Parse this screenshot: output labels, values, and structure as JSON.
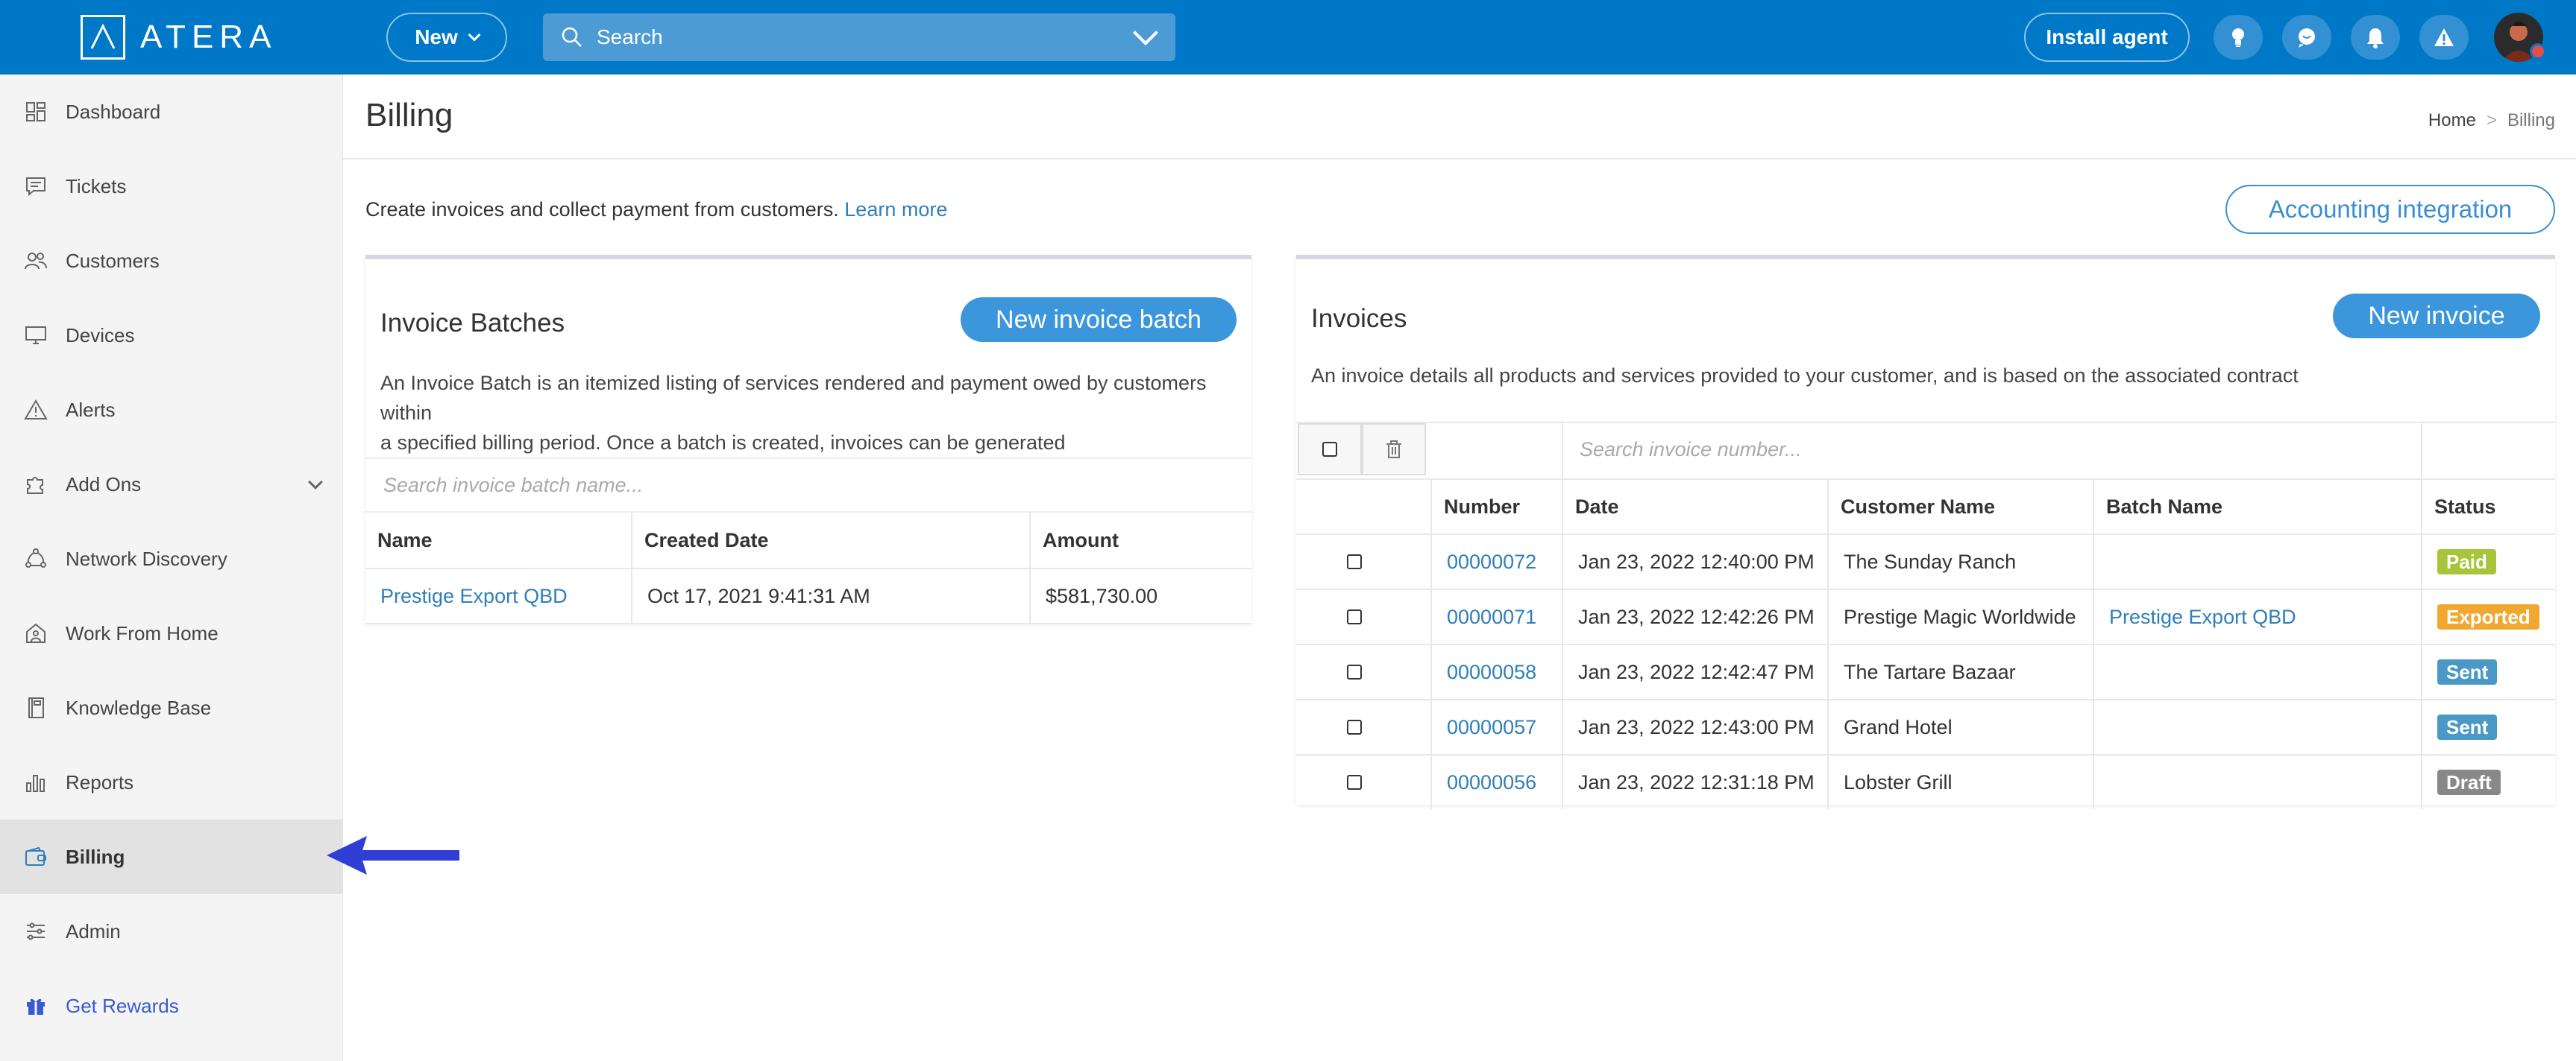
{
  "topbar": {
    "brand": "ATERA",
    "new_label": "New",
    "search_label": "Search",
    "install_label": "Install agent",
    "icons": [
      "lightbulb-icon",
      "chat-icon",
      "bell-icon",
      "warning-icon"
    ]
  },
  "sidebar": {
    "items": [
      {
        "label": "Dashboard",
        "icon": "dashboard-icon"
      },
      {
        "label": "Tickets",
        "icon": "tickets-icon"
      },
      {
        "label": "Customers",
        "icon": "customers-icon"
      },
      {
        "label": "Devices",
        "icon": "devices-icon"
      },
      {
        "label": "Alerts",
        "icon": "alerts-icon"
      },
      {
        "label": "Add Ons",
        "icon": "addons-icon"
      },
      {
        "label": "Network Discovery",
        "icon": "network-icon"
      },
      {
        "label": "Work From Home",
        "icon": "home-icon"
      },
      {
        "label": "Knowledge Base",
        "icon": "book-icon"
      },
      {
        "label": "Reports",
        "icon": "reports-icon"
      },
      {
        "label": "Billing",
        "icon": "wallet-icon"
      },
      {
        "label": "Admin",
        "icon": "sliders-icon"
      },
      {
        "label": "Get Rewards",
        "icon": "gift-icon"
      }
    ],
    "active": "Billing"
  },
  "page": {
    "title": "Billing",
    "breadcrumb": {
      "home": "Home",
      "sep": ">",
      "current": "Billing"
    },
    "intro_text": "Create invoices and collect payment from customers.",
    "learn_more": "Learn more",
    "accounting_label": "Accounting integration"
  },
  "batches": {
    "title": "Invoice Batches",
    "new_label": "New invoice batch",
    "description_line1": "An Invoice Batch is an itemized listing of services rendered and payment owed by customers within",
    "description_line2": "a specified billing period. Once a batch is created, invoices can be generated",
    "search_placeholder": "Search invoice batch name...",
    "columns": {
      "name": "Name",
      "created": "Created Date",
      "amount": "Amount"
    },
    "rows": [
      {
        "name": "Prestige Export QBD",
        "created": "Oct 17, 2021 9:41:31 AM",
        "amount": "$581,730.00"
      }
    ]
  },
  "invoices": {
    "title": "Invoices",
    "new_label": "New invoice",
    "description": "An invoice details all products and services provided to your customer, and is based on the associated contract",
    "search_placeholder": "Search invoice number...",
    "columns": {
      "number": "Number",
      "date": "Date",
      "customer": "Customer Name",
      "batch": "Batch Name",
      "status": "Status"
    },
    "rows": [
      {
        "number": "00000072",
        "date": "Jan 23, 2022 12:40:00 PM",
        "customer": "The Sunday Ranch",
        "batch": "",
        "status": "Paid",
        "status_color": "#a8c43a"
      },
      {
        "number": "00000071",
        "date": "Jan 23, 2022 12:42:26 PM",
        "customer": "Prestige Magic Worldwide",
        "batch": "Prestige Export QBD",
        "status": "Exported",
        "status_color": "#f0a830"
      },
      {
        "number": "00000058",
        "date": "Jan 23, 2022 12:42:47 PM",
        "customer": "The Tartare Bazaar",
        "batch": "",
        "status": "Sent",
        "status_color": "#4a98c6"
      },
      {
        "number": "00000057",
        "date": "Jan 23, 2022 12:43:00 PM",
        "customer": "Grand Hotel",
        "batch": "",
        "status": "Sent",
        "status_color": "#4a98c6"
      },
      {
        "number": "00000056",
        "date": "Jan 23, 2022 12:31:18 PM",
        "customer": "Lobster Grill",
        "batch": "",
        "status": "Draft",
        "status_color": "#888888"
      }
    ]
  },
  "colors": {
    "topbar": "#0078c8",
    "accent": "#3b96db",
    "link": "#2f7fb9",
    "annotation_arrow": "#2f3fd6"
  }
}
